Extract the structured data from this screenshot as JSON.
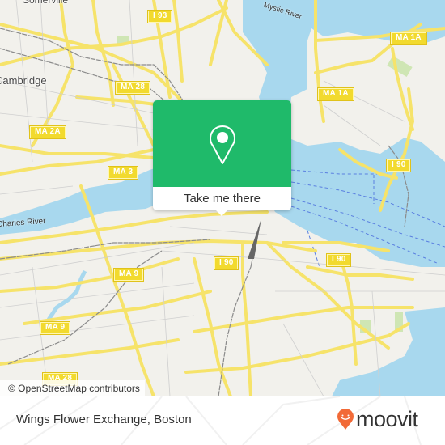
{
  "map": {
    "place_labels": {
      "somerville": "Somerville",
      "cambridge": "Cambridge"
    },
    "water_labels": {
      "mystic_river": "Mystic River",
      "charles_river": "Charles River"
    },
    "shields": {
      "i93": "I 93",
      "ma28_top": "MA 28",
      "ma1a_top": "MA 1A",
      "ma1a_mid": "MA 1A",
      "ma2a": "MA 2A",
      "ma3": "MA 3",
      "i90_east": "I 90",
      "i90_center": "I 90",
      "i90_south": "I 90",
      "ma9_center": "MA 9",
      "ma9_west": "MA 9",
      "ma28_bottom": "MA 28"
    },
    "attribution": "© OpenStreetMap contributors",
    "colors": {
      "land": "#f2f1ec",
      "water": "#a8d8ee",
      "road": "#f6e36a",
      "park": "#cfe6b4"
    }
  },
  "popup": {
    "cta_label": "Take me there",
    "accent_color": "#1fba6a"
  },
  "footer": {
    "place_name": "Wings Flower Exchange, Boston",
    "brand_name": "moovit",
    "brand_color": "#f26a37"
  }
}
